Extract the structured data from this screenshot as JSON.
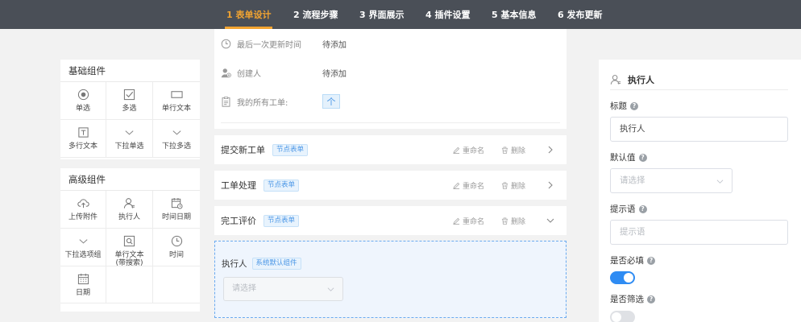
{
  "nav": {
    "tabs": [
      {
        "label": "1 表单设计",
        "active": true
      },
      {
        "label": "2 流程步骤",
        "active": false
      },
      {
        "label": "3 界面展示",
        "active": false
      },
      {
        "label": "4 插件设置",
        "active": false
      },
      {
        "label": "5 基本信息",
        "active": false
      },
      {
        "label": "6 发布更新",
        "active": false
      }
    ],
    "active_color": "#f2a431",
    "bar_color": "#4a4f57"
  },
  "basic_components": {
    "title": "基础组件",
    "items": [
      {
        "label": "单选",
        "icon": "radio-icon"
      },
      {
        "label": "多选",
        "icon": "checkbox-icon"
      },
      {
        "label": "单行文本",
        "icon": "single-line-text-icon"
      },
      {
        "label": "多行文本",
        "icon": "multi-line-text-icon"
      },
      {
        "label": "下拉单选",
        "icon": "chevron-down-icon"
      },
      {
        "label": "下拉多选",
        "icon": "chevron-down-icon"
      }
    ]
  },
  "advanced_components": {
    "title": "高级组件",
    "items": [
      {
        "label": "上传附件",
        "icon": "upload-cloud-icon"
      },
      {
        "label": "执行人",
        "icon": "user-icon"
      },
      {
        "label": "时间日期",
        "icon": "calendar-clock-icon"
      },
      {
        "label": "下拉选项组",
        "icon": "chevron-down-icon"
      },
      {
        "label": "单行文本\n(带搜索)",
        "icon": "search-box-icon"
      },
      {
        "label": "时间",
        "icon": "clock-icon"
      },
      {
        "label": "日期",
        "icon": "calendar-icon"
      }
    ]
  },
  "info": {
    "last_update_label": "最后一次更新时间",
    "last_update_value": "待添加",
    "creator_label": "创建人",
    "creator_value": "待添加",
    "my_orders_label": "我的所有工单:",
    "up_button": "个"
  },
  "steps": [
    {
      "title": "提交新工单",
      "badge": "节点表单",
      "rename": "重命名",
      "delete": "删除",
      "expanded": false
    },
    {
      "title": "工单处理",
      "badge": "节点表单",
      "rename": "重命名",
      "delete": "删除",
      "expanded": false
    },
    {
      "title": "完工评价",
      "badge": "节点表单",
      "rename": "重命名",
      "delete": "删除",
      "expanded": true
    }
  ],
  "dropzone": {
    "label": "执行人",
    "badge": "系统默认组件",
    "select_placeholder": "请选择"
  },
  "props": {
    "header": "执行人",
    "title_label": "标题",
    "title_value": "执行人",
    "default_label": "默认值",
    "default_placeholder": "请选择",
    "hint_label": "提示语",
    "hint_placeholder": "提示语",
    "required_label": "是否必填",
    "required_on": true,
    "filter_label": "是否筛选",
    "filter_on": false
  },
  "colors": {
    "primary": "#2f8cf3",
    "badge_blue": "#4a96e6"
  }
}
